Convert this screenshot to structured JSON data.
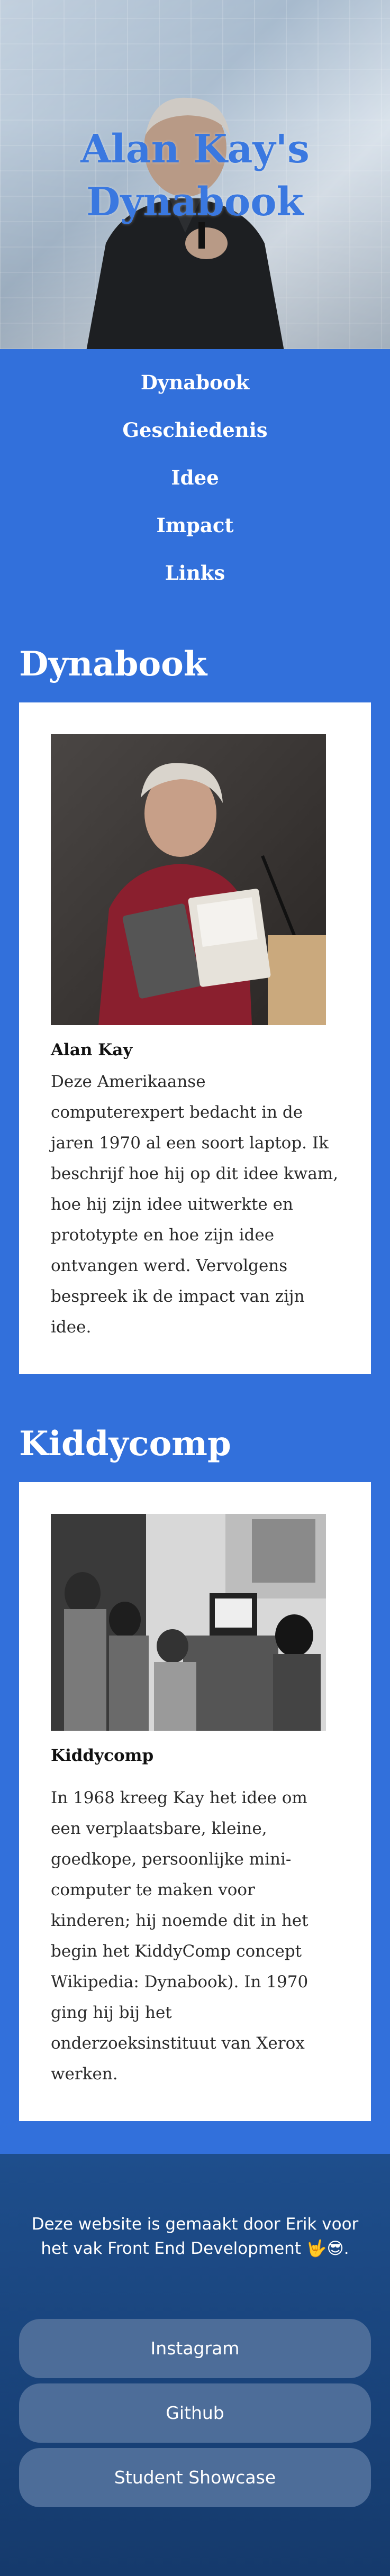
{
  "hero": {
    "title": "Alan Kay's Dynabook"
  },
  "nav": {
    "items": [
      "Dynabook",
      "Geschiedenis",
      "Idee",
      "Impact",
      "Links"
    ]
  },
  "sections": [
    {
      "heading": "Dynabook",
      "caption": "Alan Kay",
      "text": "Deze Amerikaanse computerexpert bedacht in de jaren 1970 al een soort laptop. Ik beschrijf hoe hij op dit idee kwam, hoe hij zijn idee uitwerkte en prototypte en hoe zijn idee ontvangen werd. Vervolgens bespreek ik de impact van zijn idee."
    },
    {
      "heading": "Kiddycomp",
      "caption": "Kiddycomp",
      "text": "In 1968 kreeg Kay het idee om een verplaatsbare, kleine, goedkope, persoonlijke mini-computer te maken voor kinderen; hij noemde dit in het begin het KiddyComp concept Wikipedia: Dynabook). In 1970 ging hij bij het onderzoeksinstituut van Xerox werken."
    }
  ],
  "footer": {
    "note": "Deze website is gemaakt door Erik voor het vak Front End Development 🤟😎.",
    "buttons": [
      "Instagram",
      "Github",
      "Student Showcase"
    ]
  }
}
